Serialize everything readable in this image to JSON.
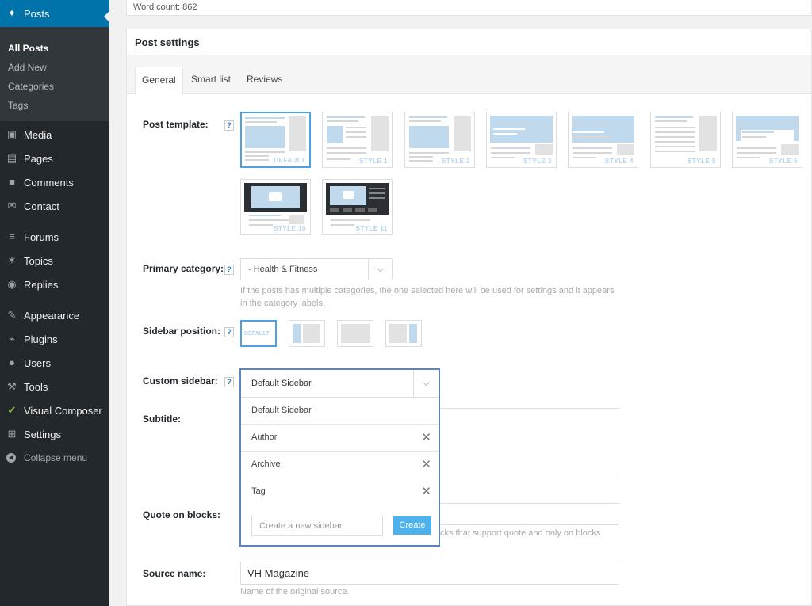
{
  "sidebar": {
    "current": {
      "label": "Posts",
      "icon": "pushpin-icon"
    },
    "submenu": [
      "All Posts",
      "Add New",
      "Categories",
      "Tags"
    ],
    "items": [
      {
        "label": "Media",
        "icon": "media-icon"
      },
      {
        "label": "Pages",
        "icon": "pages-icon"
      },
      {
        "label": "Comments",
        "icon": "comments-icon"
      },
      {
        "label": "Contact",
        "icon": "mail-icon"
      },
      {
        "label": "Forums",
        "icon": "forums-icon"
      },
      {
        "label": "Topics",
        "icon": "topics-icon"
      },
      {
        "label": "Replies",
        "icon": "replies-icon"
      },
      {
        "label": "Appearance",
        "icon": "brush-icon"
      },
      {
        "label": "Plugins",
        "icon": "plug-icon"
      },
      {
        "label": "Users",
        "icon": "user-icon"
      },
      {
        "label": "Tools",
        "icon": "wrench-icon"
      },
      {
        "label": "Visual Composer",
        "icon": "vc-icon"
      },
      {
        "label": "Settings",
        "icon": "settings-icon"
      }
    ],
    "collapse": "Collapse menu"
  },
  "editor": {
    "word_count": "Word count: 862"
  },
  "post_settings": {
    "title": "Post settings",
    "tabs": [
      "General",
      "Smart list",
      "Reviews"
    ],
    "template_label": "Post template:",
    "help": "?",
    "templates": [
      "DEFAULT",
      "STYLE 1",
      "STYLE 2",
      "STYLE 3",
      "STYLE 4",
      "STYLE 5",
      "STYLE 6",
      "STYLE 10",
      "STYLE 11"
    ],
    "primary_category_label": "Primary category:",
    "primary_category_value": "- Health & Fitness",
    "primary_category_desc": "If the posts has multiple categories, the one selected here will be used for settings and it appears in the category labels.",
    "sidebar_position_label": "Sidebar position:",
    "sidebar_position_default": "DEFAULT",
    "custom_sidebar_label": "Custom sidebar:",
    "subtitle_label": "Subtitle:",
    "quote_label": "Quote on blocks:",
    "quote_desc_partial": "cks that support quote and only on blocks",
    "source_name_label": "Source name:",
    "source_name_value": "VH Magazine",
    "source_name_desc": "Name of the original source."
  },
  "custom_sidebar_dropdown": {
    "selected": "Default Sidebar",
    "options": [
      "Default Sidebar",
      "Author",
      "Archive",
      "Tag"
    ],
    "new_placeholder": "Create a new sidebar",
    "create_label": "Create"
  },
  "colors": {
    "admin_blue": "#0073aa",
    "selection_blue": "#4fa1e0",
    "dropdown_border": "#5b84c7",
    "create_button": "#4db2ec"
  }
}
